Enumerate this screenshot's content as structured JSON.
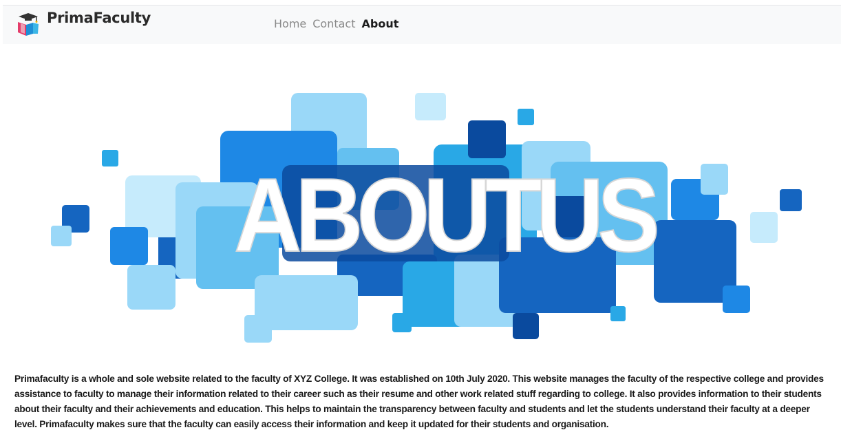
{
  "brand": {
    "name": "PrimaFaculty",
    "logo_icon": "graduation-cap-books-icon"
  },
  "nav": {
    "items": [
      {
        "label": "Home",
        "active": false
      },
      {
        "label": "Contact",
        "active": false
      },
      {
        "label": "About",
        "active": true
      }
    ]
  },
  "banner": {
    "heading": "ABOUTUS",
    "colors": [
      "#0a4a9e",
      "#1565c0",
      "#1e88e5",
      "#29a8e6",
      "#64c0f0",
      "#9ad8f8",
      "#c6ebfc"
    ]
  },
  "about": {
    "paragraph": "Primafaculty is a whole and sole website related to the faculty of XYZ College. It was established on 10th July 2020. This website manages the faculty of the respective college and provides assistance to faculty to manage their information related to their career such as their resume and other work related stuff regarding to college. It also provides information to their students about their faculty and their achievements and education. This helps to maintain the transparency between faculty and students and let the students understand their faculty at a deeper level. Primafaculty makes sure that the faculty can easily access their information and keep it updated for their students and organisation."
  }
}
